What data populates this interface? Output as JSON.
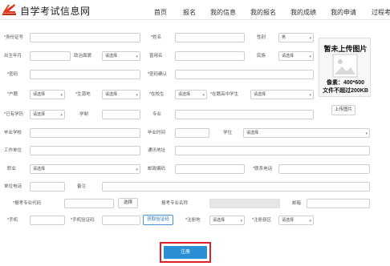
{
  "header": {
    "site_title": "自学考试信息网",
    "nav": [
      "首页",
      "报名",
      "我的信息",
      "我的报名",
      "我的成绩",
      "我的申请",
      "过程考"
    ]
  },
  "form": {
    "id_label": "*身份证号",
    "name_label": "*姓名",
    "gender_label": "性别",
    "gender_value": "男",
    "birth_label": "出生年月",
    "political_label": "政治面貌",
    "political_value": "请选择",
    "former_name_label": "曾用名",
    "ethnic_label": "民族",
    "ethnic_value": "请选择",
    "password_label": "*密码",
    "password_confirm_label": "*密码确认",
    "hukou_label": "*户籍",
    "hukou_value": "请选择",
    "origin_label": "*生源地",
    "origin_value": "请选择",
    "in_school_label": "*在校生",
    "in_school_value": "请选择",
    "in_school_type_label": "*在籍高中学生",
    "in_school_type_value": "请选择",
    "degree_label": "*已有学历",
    "degree_value": "请选择",
    "schooling_label": "学制",
    "major_label": "专业",
    "grad_school_label": "毕业学校",
    "grad_time_label": "毕业时间",
    "academic_degree_label": "学位",
    "academic_degree_value": "请选择",
    "work_unit_label": "工作单位",
    "address_label": "通讯地址",
    "job_label": "职业",
    "job_value": "请选择",
    "postcode_label": "邮政编码",
    "contact_phone_label": "*联系电话",
    "unit_phone_label": "单位电话",
    "remark_label": "备注",
    "exam_code_label": "*报考专业代码",
    "select_button": "选择",
    "exam_name_label": "报考专业名称",
    "email_label": "邮箱",
    "mobile_label": "*手机",
    "mobile_code_label": "*手机验证码",
    "get_code_button": "获取验证码",
    "reg_place_label": "*注册地",
    "reg_place_value": "请选择",
    "reg_district_label": "*注册县区",
    "reg_district_value": "请选择"
  },
  "photo": {
    "title": "暂未上传图片",
    "size_text": "像素：400*600",
    "limit_text": "文件不超过200KB",
    "upload_button": "上传图片"
  },
  "register_button": "注册",
  "colors": {
    "primary": "#2a8fd4",
    "highlight": "#e0202a",
    "logo": "#e03a1e"
  }
}
